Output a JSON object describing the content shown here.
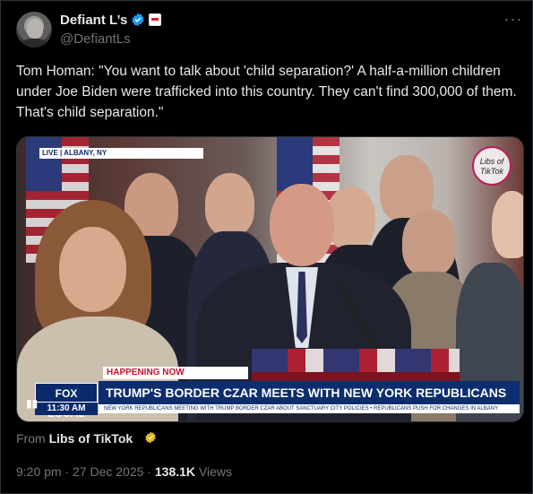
{
  "author": {
    "name": "Defiant L’s",
    "handle": "@DefiantLs"
  },
  "tweet_text": "Tom Homan: \"You want to talk about 'child separation?' A half-a-million children under Joe Biden were trafficked into this country. They can't find 300,000 of them. That's child separation.\"",
  "media": {
    "live_tag": "LIVE | ALBANY, NY",
    "watermark": "Libs of TikTok",
    "happening_now": "HAPPENING NOW",
    "network_logo": "FOX LOCAL",
    "headline": "TRUMP'S BORDER CZAR MEETS WITH NEW YORK REPUBLICANS",
    "time": "11:30 AM",
    "ticker": "NEW YORK REPUBLICANS MEETING WITH TRUMP BORDER CZAR ABOUT SANCTUARY CITY POLICIES • REPUBLICANS PUSH FOR CHANGES IN ALBANY"
  },
  "attribution": {
    "prefix": "From",
    "source": "Libs of TikTok"
  },
  "timestamp": "9:20 pm · 27 Dec 2025 · ",
  "views_count": "138.1K",
  "views_label": " Views",
  "colors": {
    "background": "#000000",
    "text": "#e7e9ea",
    "secondary": "#71767b",
    "verified_blue": "#1d9bf0",
    "gold_badge": "#e2b719",
    "fox_blue": "#0d2d6e"
  },
  "icons": [
    "verified-badge-icon",
    "affiliate-badge-icon",
    "more-icon",
    "gold-badge-icon"
  ]
}
